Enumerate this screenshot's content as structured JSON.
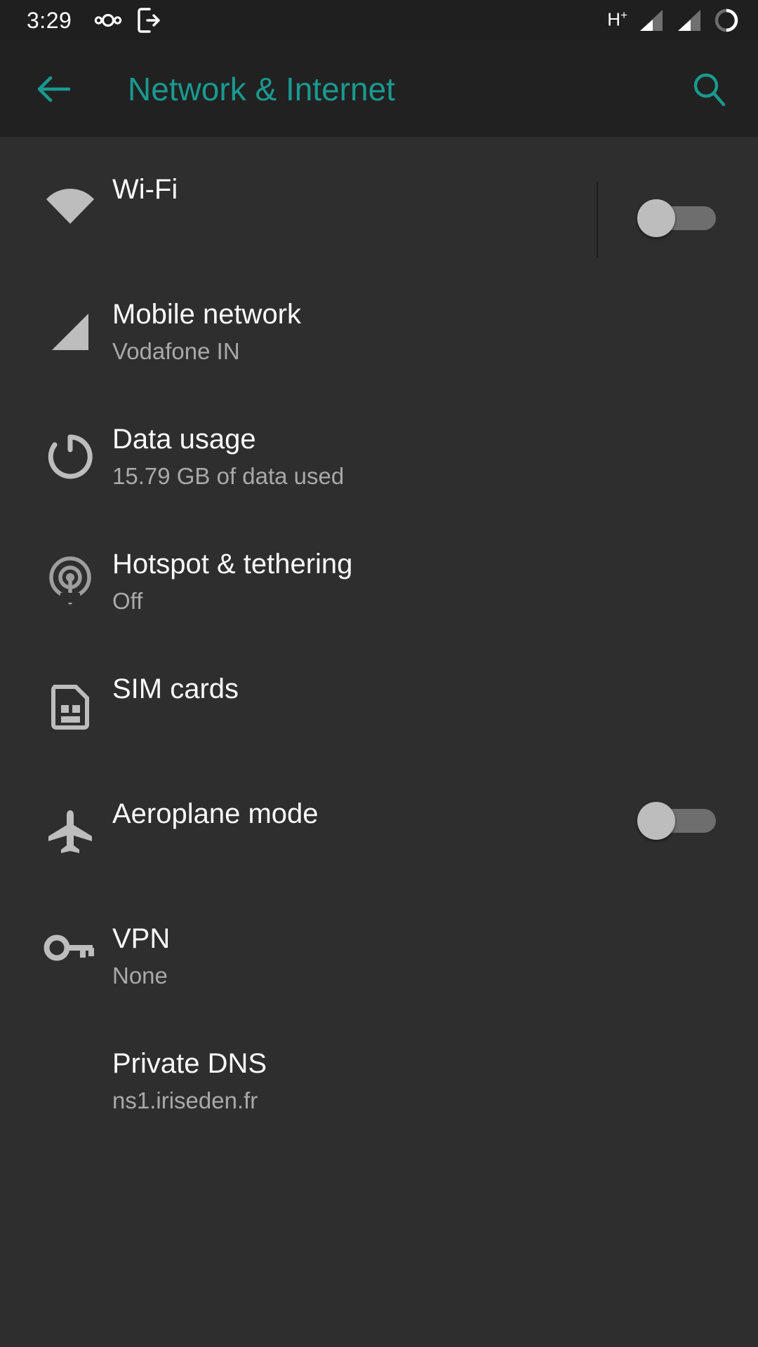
{
  "status_bar": {
    "time": "3:29",
    "left_icons": [
      "lineageos-logo-icon",
      "screen-cast-export-icon"
    ],
    "network_type": "H",
    "network_type_sup": "+",
    "right_icons": [
      "signal-bars-sim1-icon",
      "signal-bars-sim2-icon",
      "battery-circle-icon"
    ],
    "background_color": "#1f1f1f",
    "foreground_color": "#ffffff"
  },
  "app_bar": {
    "back_icon": "arrow-back-icon",
    "title": "Network & Internet",
    "search_icon": "search-icon",
    "accent_color": "#1a998f",
    "background_color": "#212121"
  },
  "list": {
    "background_color": "#2e2e2e",
    "title_color": "#fafafa",
    "subtitle_color": "#a9a9a9",
    "items": [
      {
        "icon": "wifi-icon",
        "title": "Wi-Fi",
        "subtitle": "",
        "widget": "switch",
        "switch_state": "off",
        "has_divider": true
      },
      {
        "icon": "signal-cellular-icon",
        "title": "Mobile network",
        "subtitle": "Vodafone IN",
        "widget": "none",
        "switch_state": "",
        "has_divider": false
      },
      {
        "icon": "data-usage-icon",
        "title": "Data usage",
        "subtitle": "15.79 GB of data used",
        "widget": "none",
        "switch_state": "",
        "has_divider": false
      },
      {
        "icon": "hotspot-tethering-icon",
        "title": "Hotspot & tethering",
        "subtitle": "Off",
        "widget": "none",
        "switch_state": "",
        "has_divider": false
      },
      {
        "icon": "sim-card-icon",
        "title": "SIM cards",
        "subtitle": "",
        "widget": "none",
        "switch_state": "",
        "has_divider": false
      },
      {
        "icon": "airplane-icon",
        "title": "Aeroplane mode",
        "subtitle": "",
        "widget": "switch",
        "switch_state": "off",
        "has_divider": false
      },
      {
        "icon": "vpn-key-icon",
        "title": "VPN",
        "subtitle": "None",
        "widget": "none",
        "switch_state": "",
        "has_divider": false
      },
      {
        "icon": "none",
        "title": "Private DNS",
        "subtitle": "ns1.iriseden.fr",
        "widget": "none",
        "switch_state": "",
        "has_divider": false
      }
    ]
  }
}
